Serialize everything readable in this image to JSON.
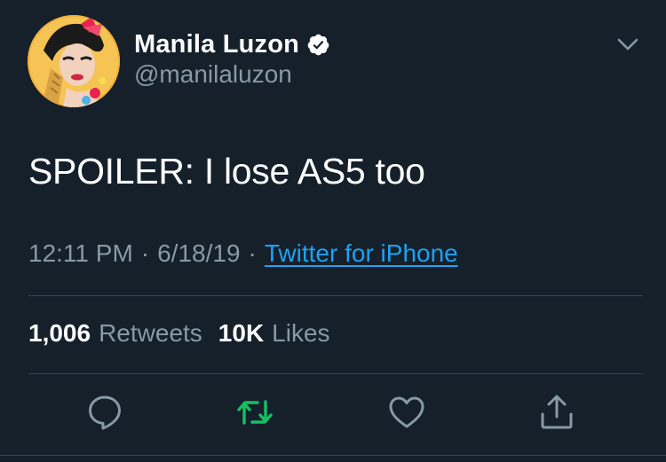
{
  "author": {
    "display_name": "Manila Luzon",
    "handle": "@manilaluzon",
    "verified": true,
    "avatar_icon": "profile-photo"
  },
  "tweet": {
    "text": "SPOILER: I lose AS5 too",
    "time": "12:11 PM",
    "date": "6/18/19",
    "separator": "·",
    "source": "Twitter for iPhone"
  },
  "stats": {
    "retweets_count": "1,006",
    "retweets_label": "Retweets",
    "likes_count": "10K",
    "likes_label": "Likes"
  },
  "actions": {
    "reply_icon": "reply-icon",
    "retweet_icon": "retweet-icon",
    "like_icon": "heart-icon",
    "share_icon": "share-icon"
  },
  "colors": {
    "background": "#15202b",
    "text_primary": "#ffffff",
    "text_secondary": "#8899a6",
    "link": "#1da1f2",
    "divider": "#38444d",
    "retweet_green": "#17bf63"
  }
}
